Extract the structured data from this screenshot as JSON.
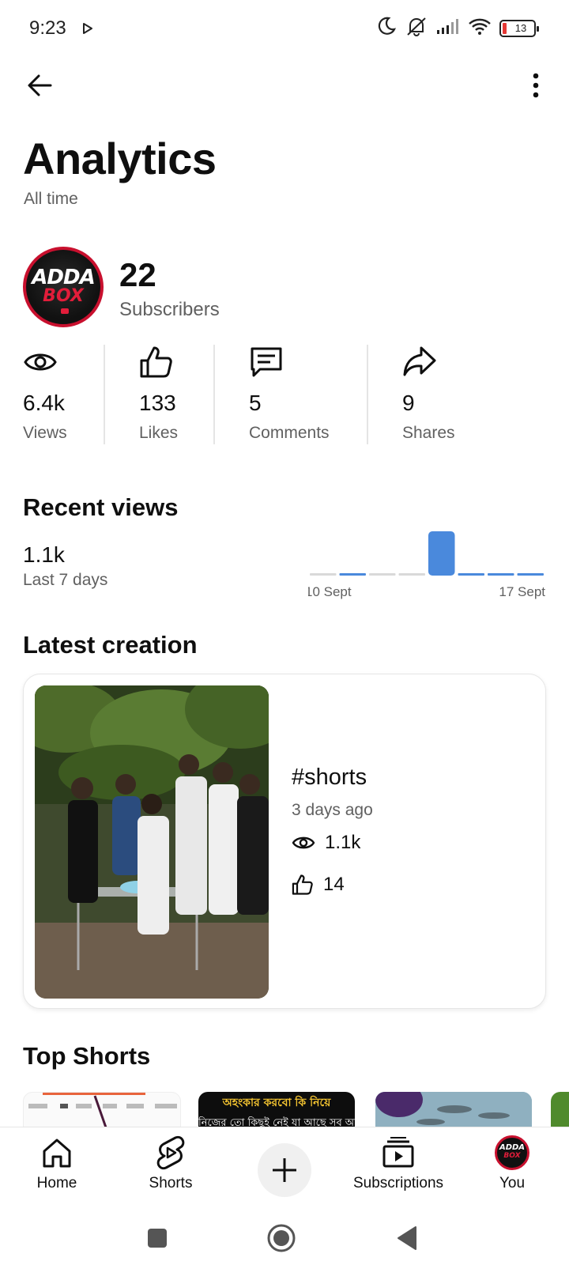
{
  "status_bar": {
    "time": "9:23",
    "battery": "13"
  },
  "header": {
    "title": "Analytics",
    "subtitle": "All time"
  },
  "channel": {
    "logo_line1": "ADDA",
    "logo_line2": "BOX",
    "subscribers_value": "22",
    "subscribers_label": "Subscribers"
  },
  "stats": [
    {
      "value": "6.4k",
      "label": "Views",
      "icon": "eye-icon"
    },
    {
      "value": "133",
      "label": "Likes",
      "icon": "thumbs-up-icon"
    },
    {
      "value": "5",
      "label": "Comments",
      "icon": "comment-icon"
    },
    {
      "value": "9",
      "label": "Shares",
      "icon": "share-icon"
    }
  ],
  "recent_views": {
    "title": "Recent views",
    "value": "1.1k",
    "period": "Last 7 days",
    "accent_color": "#4a89dc",
    "baseline_color": "#d9d9d9"
  },
  "chart_data": {
    "type": "bar",
    "title": "",
    "x_start_label": "10 Sept",
    "x_end_label": "17 Sept",
    "values": [
      0,
      0.03,
      0,
      0,
      1.0,
      0.03,
      0.03,
      0.03
    ],
    "value_scale": "relative"
  },
  "latest_creation": {
    "section_title": "Latest creation",
    "title": "#shorts",
    "date": "3 days ago",
    "views": "1.1k",
    "likes": "14"
  },
  "top_shorts": {
    "section_title": "Top Shorts",
    "short2_text_line1": "অহংকার করবো কি নিয়ে",
    "short2_text_line2": "নিজের তো কিছুই নেই যা আছে সব আমার"
  },
  "bottom_nav": [
    {
      "label": "Home",
      "icon": "home-icon"
    },
    {
      "label": "Shorts",
      "icon": "shorts-icon"
    },
    {
      "label": "",
      "icon": "create-plus-icon"
    },
    {
      "label": "Subscriptions",
      "icon": "subscriptions-icon"
    },
    {
      "label": "You",
      "icon": "avatar"
    }
  ]
}
